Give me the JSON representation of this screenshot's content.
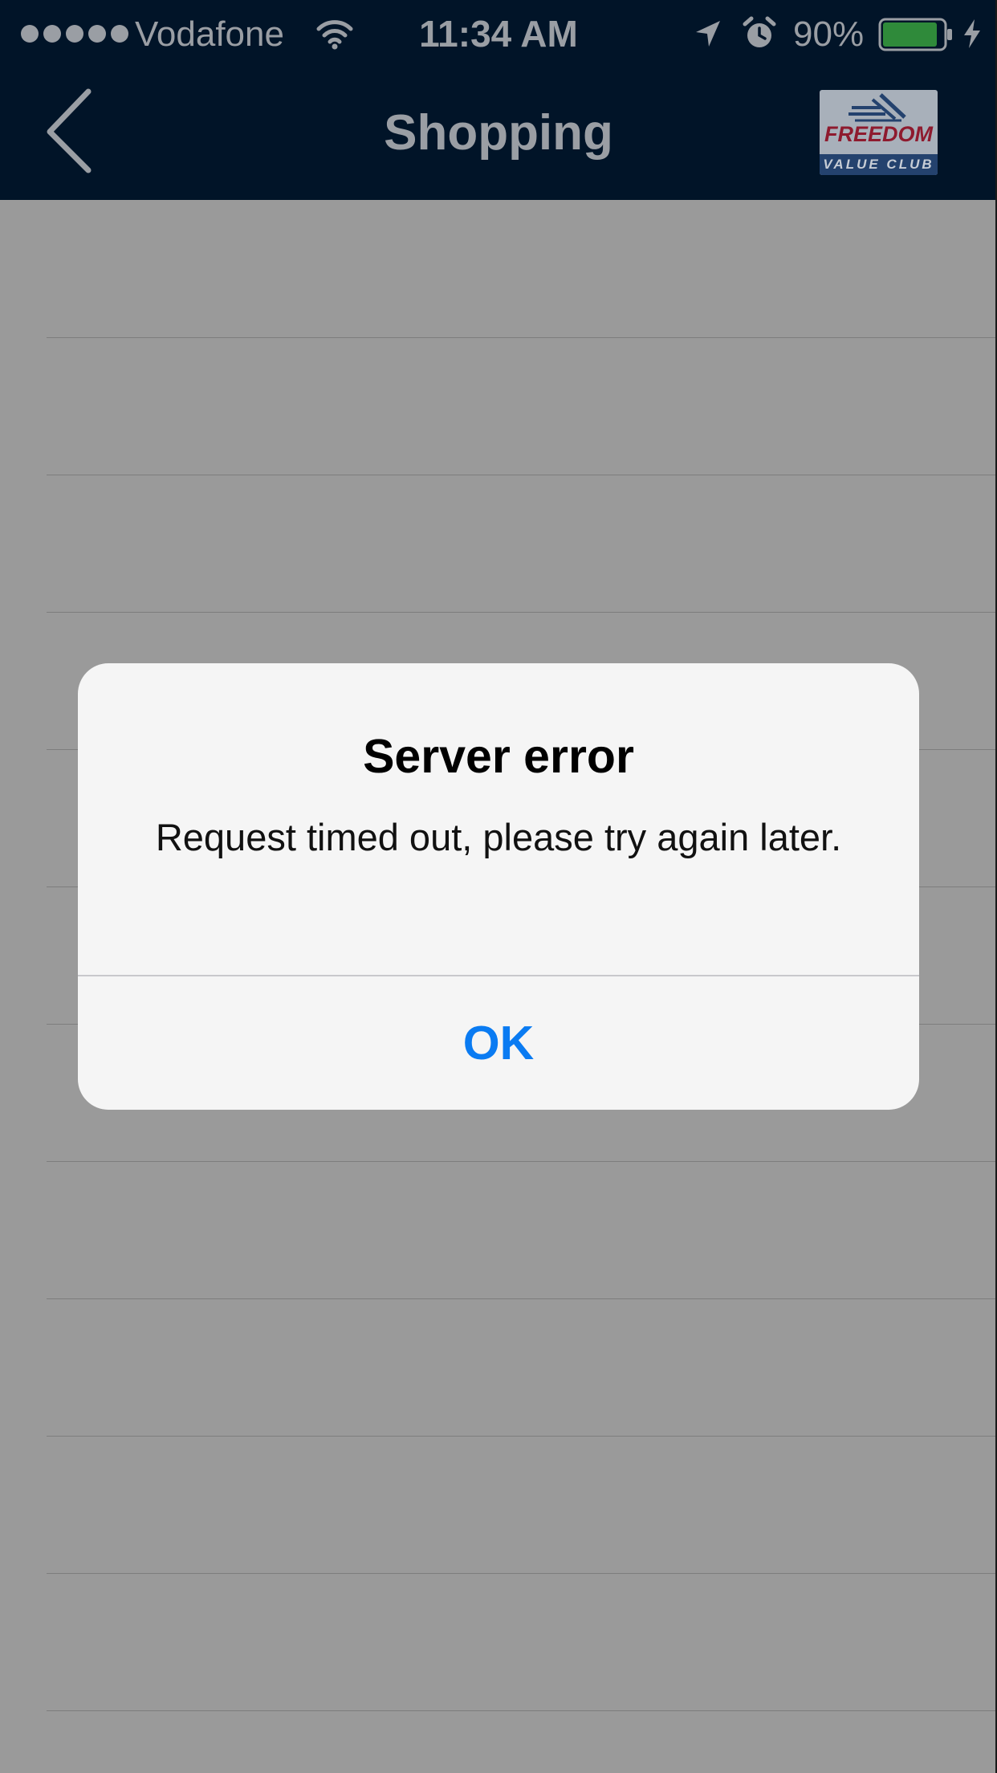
{
  "status_bar": {
    "carrier": "Vodafone",
    "time": "11:34 AM",
    "battery_percent": "90%",
    "battery_level": 0.9,
    "signal_bars": 5,
    "icons": [
      "signal-dots-icon",
      "wifi-icon",
      "location-arrow-icon",
      "alarm-clock-icon",
      "battery-icon",
      "charging-bolt-icon"
    ]
  },
  "nav": {
    "title": "Shopping",
    "back_icon": "chevron-left-icon",
    "logo": {
      "word": "FREEDOM",
      "band": "VALUE CLUB"
    }
  },
  "list": {
    "row_count": 11
  },
  "alert": {
    "title": "Server error",
    "message": "Request timed out, please try again later.",
    "button_label": "OK"
  },
  "colors": {
    "header_bg": "#011428",
    "overlay_bg": "#9a9a9a",
    "alert_bg": "#f5f5f5",
    "button_blue": "#0a7bf2",
    "battery_green": "#2f8a3a",
    "logo_red": "#8e1a2e",
    "logo_navy": "#24426e"
  }
}
